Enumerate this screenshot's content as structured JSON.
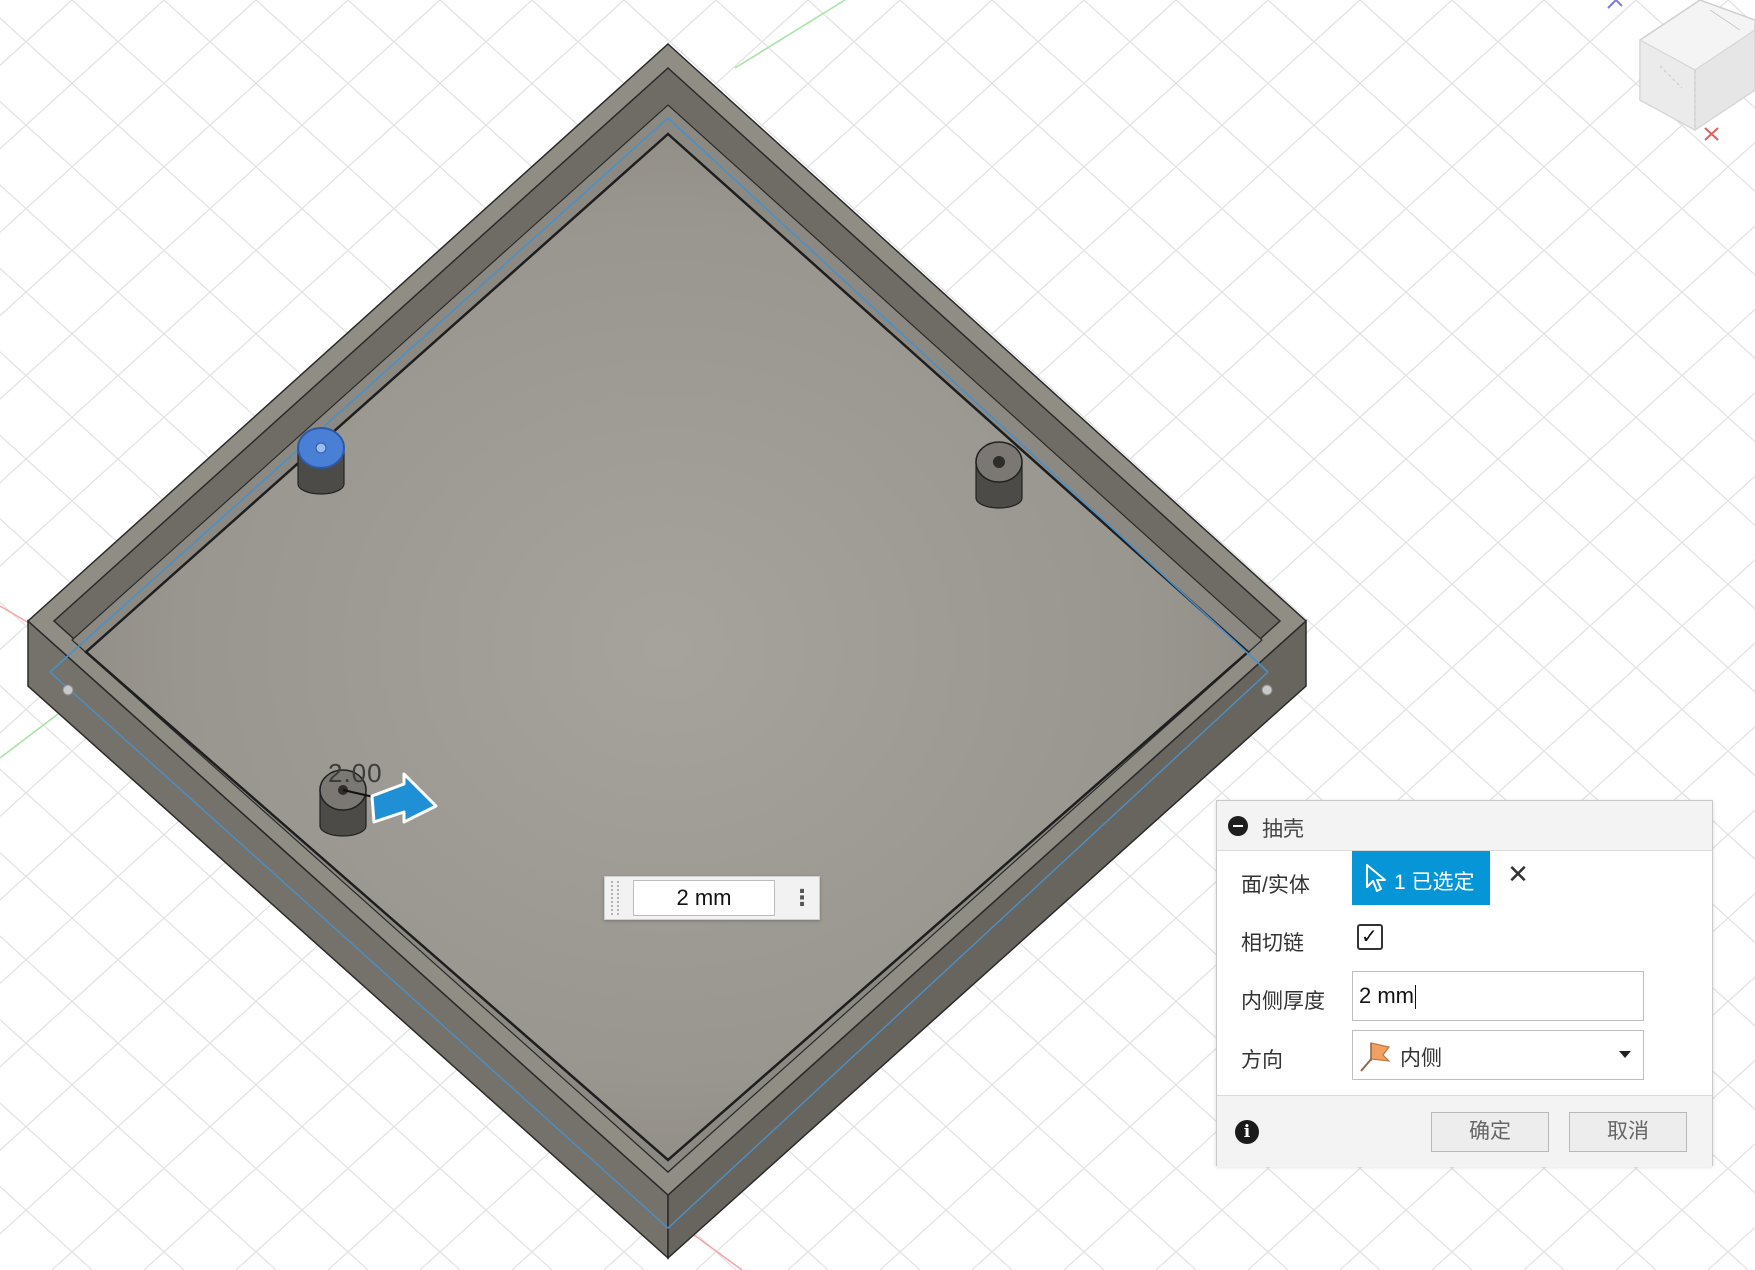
{
  "viewport": {
    "dimension_label": "2.00",
    "inline_value": "2 mm"
  },
  "shell_dialog": {
    "title": "抽壳",
    "faces_label": "面/实体",
    "selection_text": "1 已选定",
    "tangent_chain_label": "相切链",
    "tangent_chain_checked": true,
    "thickness_label": "内侧厚度",
    "thickness_value": "2 mm",
    "direction_label": "方向",
    "direction_value": "内侧",
    "ok_label": "确定",
    "cancel_label": "取消"
  },
  "colors": {
    "accent": "#0696d7",
    "selected_face": "#4a7fd6",
    "body": "#8f8c84"
  },
  "icons": [
    "collapse-icon",
    "cursor-icon",
    "close-icon",
    "direction-icon",
    "info-icon",
    "arrow-manipulator-icon",
    "view-cube-icon"
  ]
}
